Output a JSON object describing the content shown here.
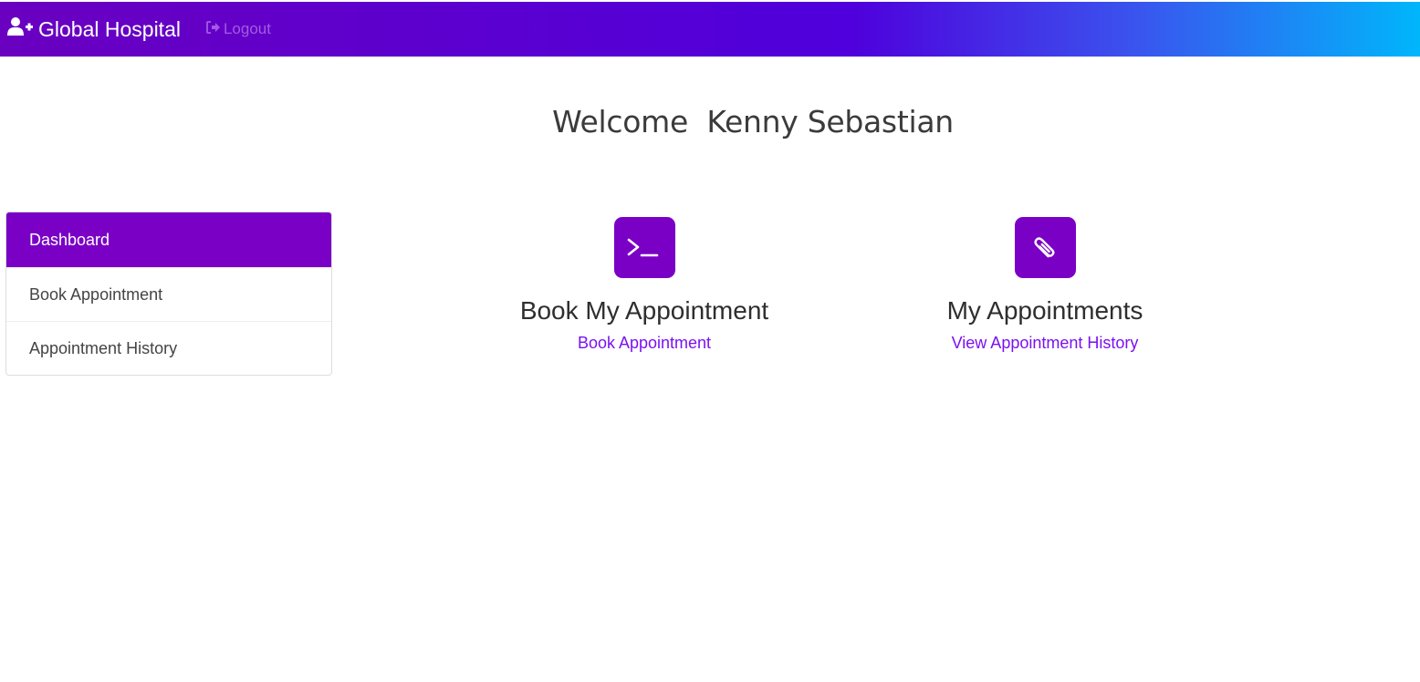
{
  "navbar": {
    "brand_label": "Global Hospital",
    "brand_icon": "user-plus-icon",
    "logout_label": "Logout",
    "logout_icon": "sign-out-icon",
    "gradient_colors": [
      "#6a00c0",
      "#4f00dc",
      "#00b6fb"
    ]
  },
  "welcome": {
    "text": "Welcome  Kenny Sebastian"
  },
  "sidebar": {
    "items": [
      {
        "label": "Dashboard",
        "active": true
      },
      {
        "label": "Book Appointment",
        "active": false
      },
      {
        "label": "Appointment History",
        "active": false
      }
    ],
    "active_color": "#7a00c6"
  },
  "cards": [
    {
      "icon": "terminal-icon",
      "title": "Book My Appointment",
      "link": "Book Appointment"
    },
    {
      "icon": "paperclip-icon",
      "title": "My Appointments",
      "link": "View Appointment History"
    }
  ],
  "accent_color": "#7a11f2"
}
